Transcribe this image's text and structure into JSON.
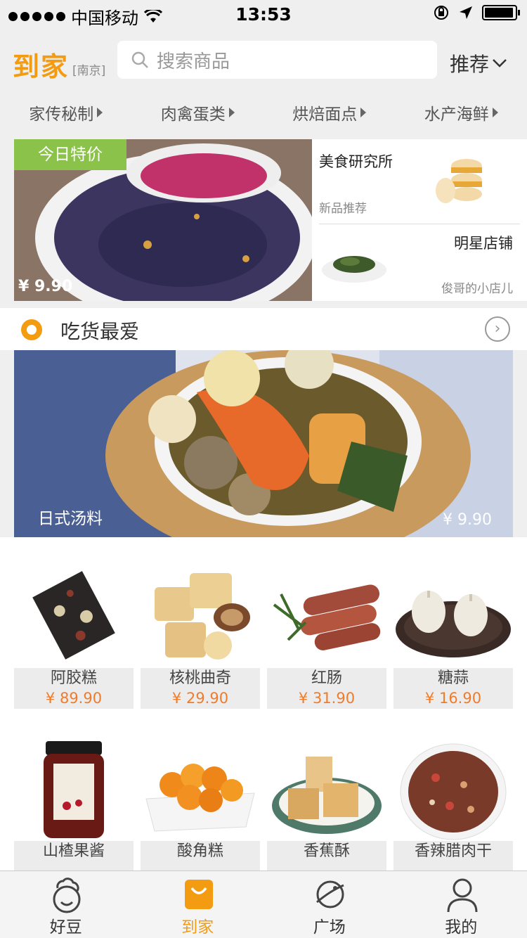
{
  "status": {
    "carrier": "中国移动",
    "time": "13:53"
  },
  "header": {
    "logo": "到家",
    "city": "[南京]",
    "search_placeholder": "搜索商品",
    "sort_label": "推荐"
  },
  "categories": [
    "家传秘制",
    "肉禽蛋类",
    "烘焙面点",
    "水产海鲜"
  ],
  "promo": {
    "tag": "今日特价",
    "price": "¥ 9.90"
  },
  "side": {
    "a_title": "美食研究所",
    "a_sub": "新品推荐",
    "b_title": "明星店铺",
    "b_sub": "俊哥的小店儿"
  },
  "section": {
    "title": "吃货最爱"
  },
  "banner": {
    "name": "日式汤料",
    "price": "¥ 9.90"
  },
  "products": [
    {
      "name": "阿胶糕",
      "price": "¥ 89.90"
    },
    {
      "name": "核桃曲奇",
      "price": "¥ 29.90"
    },
    {
      "name": "红肠",
      "price": "¥ 31.90"
    },
    {
      "name": "糖蒜",
      "price": "¥ 16.90"
    },
    {
      "name": "山楂果酱",
      "price": ""
    },
    {
      "name": "酸角糕",
      "price": ""
    },
    {
      "name": "香蕉酥",
      "price": ""
    },
    {
      "name": "香辣腊肉干",
      "price": ""
    }
  ],
  "tabs": [
    {
      "label": "好豆",
      "icon": "chef-icon"
    },
    {
      "label": "到家",
      "icon": "bag-icon"
    },
    {
      "label": "广场",
      "icon": "planet-icon"
    },
    {
      "label": "我的",
      "icon": "user-icon"
    }
  ],
  "colors": {
    "accent": "#f39c12",
    "price": "#f07b2a",
    "tag": "#8bc34a"
  }
}
